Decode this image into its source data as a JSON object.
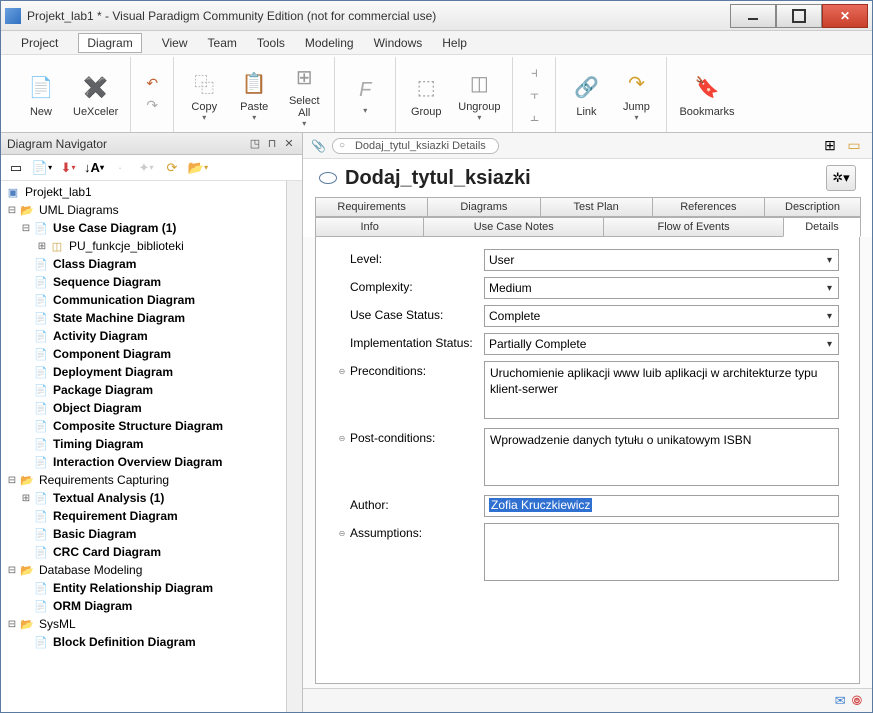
{
  "title": "Projekt_lab1 * - Visual Paradigm Community Edition (not for commercial use)",
  "menubar": [
    "Project",
    "Diagram",
    "View",
    "Team",
    "Tools",
    "Modeling",
    "Windows",
    "Help"
  ],
  "menubar_active": 1,
  "ribbon": {
    "new": "New",
    "uexceler": "UeXceler",
    "copy": "Copy",
    "paste": "Paste",
    "select_all": "Select\nAll",
    "group": "Group",
    "ungroup": "Ungroup",
    "link": "Link",
    "jump": "Jump",
    "bookmarks": "Bookmarks"
  },
  "navigator": {
    "title": "Diagram Navigator",
    "root": "Projekt_lab1",
    "uml": "UML Diagrams",
    "use_case": "Use Case Diagram (1)",
    "pu_funkcje": "PU_funkcje_biblioteki",
    "items_uml": [
      "Class Diagram",
      "Sequence Diagram",
      "Communication Diagram",
      "State Machine Diagram",
      "Activity Diagram",
      "Component Diagram",
      "Deployment Diagram",
      "Package Diagram",
      "Object Diagram",
      "Composite Structure Diagram",
      "Timing Diagram",
      "Interaction Overview Diagram"
    ],
    "req_cap": "Requirements Capturing",
    "textual": "Textual Analysis (1)",
    "items_req": [
      "Requirement Diagram",
      "Basic Diagram",
      "CRC Card Diagram"
    ],
    "db": "Database Modeling",
    "items_db": [
      "Entity Relationship Diagram",
      "ORM Diagram"
    ],
    "sysml": "SysML",
    "items_sysml": [
      "Block Definition Diagram"
    ]
  },
  "breadcrumb": "Dodaj_tytul_ksiazki Details",
  "detail_title": "Dodaj_tytul_ksiazki",
  "tabs_row1": [
    "Requirements",
    "Diagrams",
    "Test Plan",
    "References",
    "Description"
  ],
  "tabs_row2": [
    "Info",
    "Use Case Notes",
    "Flow of Events",
    "Details"
  ],
  "tabs_row2_active": 3,
  "form": {
    "level_label": "Level:",
    "level_value": "User",
    "complexity_label": "Complexity:",
    "complexity_value": "Medium",
    "status_label": "Use Case Status:",
    "status_value": "Complete",
    "impl_label": "Implementation Status:",
    "impl_value": "Partially Complete",
    "precond_label": "Preconditions:",
    "precond_value": "Uruchomienie aplikacji www luib aplikacji w architekturze typu klient-serwer",
    "postcond_label": "Post-conditions:",
    "postcond_value": "Wprowadzenie danych tytułu o unikatowym ISBN",
    "author_label": "Author:",
    "author_value": "Zofia Kruczkiewicz",
    "assumptions_label": "Assumptions:",
    "assumptions_value": ""
  }
}
